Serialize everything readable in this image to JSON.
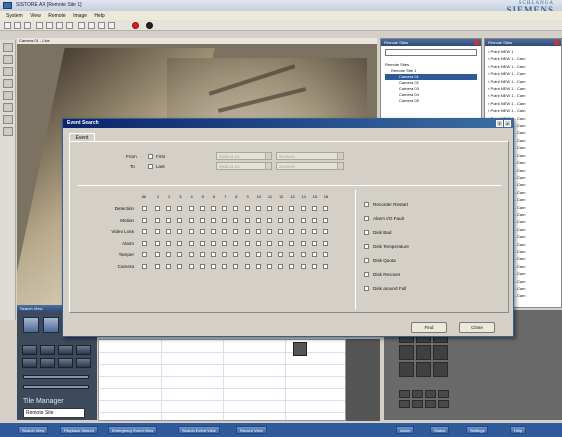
{
  "window": {
    "title": "SISTORE AX [Remote Site 1]",
    "brand_line1": "SCHLANGA",
    "brand_line2": "SIEMENS"
  },
  "menu": [
    "System",
    "View",
    "Remote",
    "Image",
    "Help"
  ],
  "video": {
    "title": "Camera 01 - Live"
  },
  "camera_panel": {
    "title": "Remote Sites",
    "tree": [
      {
        "label": "Remote Sites",
        "level": 0
      },
      {
        "label": "Remote Site 1",
        "level": 1
      },
      {
        "label": "Camera 01",
        "level": 2,
        "selected": true
      },
      {
        "label": "Camera 02",
        "level": 2
      },
      {
        "label": "Camera 03",
        "level": 2
      },
      {
        "label": "Camera 04",
        "level": 2
      },
      {
        "label": "Camera 05",
        "level": 2
      }
    ]
  },
  "record_panel": {
    "title": "Remote Sites",
    "items": [
      "Point NEW 1",
      "Point NEW 1 - Cam",
      "Point NEW 1 - Cam",
      "Point NEW 1 - Cam",
      "Point NEW 1 - Cam",
      "Point NEW 1 - Cam",
      "Point NEW 1 - Cam",
      "Point NEW 1 - Cam",
      "Point NEW 1 - Cam",
      "Point NEW 1 - Cam",
      "Point NEW 1 - Cam",
      "Point NEW 1 - Cam",
      "Point NEW 1 - Cam",
      "Point NEW 1 - Cam",
      "Point NEW 1 - Cam",
      "Point NEW 1 - Cam",
      "Point NEW 1 - Cam",
      "Point NEW 1 - Cam",
      "Point NEW 1 - Cam",
      "Point NEW 1 - Cam",
      "Point NEW 1 - Cam",
      "Point NEW 1 - Cam",
      "Point NEW 1 - Cam",
      "Point NEW 1 - Cam",
      "Point NEW 1 - Cam",
      "Point NEW 1 - Cam",
      "Point NEW 1 - Cam",
      "Point NEW 1 - Cam",
      "Point NEW 1 - Cam",
      "Point NEW 1 - Cam",
      "Point NEW 1 - Cam",
      "Point NEW 1 - Cam",
      "Point NEW 1 - Cam",
      "Point NEW 1 - Cam"
    ]
  },
  "lower_left": {
    "title": "Search View",
    "label": "Tile Manager",
    "select_value": "Remote Site"
  },
  "dialog": {
    "title": "Event Search",
    "tab": "Event",
    "from_label": "From",
    "to_label": "To",
    "first_label": "First",
    "last_label": "Last",
    "from_date": "2008-01-01",
    "from_time": "00:00:00",
    "to_date": "2008-01-01",
    "to_time": "23:59:59",
    "all_label": "All",
    "channels": [
      "1",
      "2",
      "3",
      "4",
      "5",
      "6",
      "7",
      "8",
      "9",
      "10",
      "11",
      "12",
      "13",
      "14",
      "15",
      "16"
    ],
    "rows": [
      "Detection",
      "Motion",
      "Video Loss",
      "Alarm",
      "Tamper",
      "Camera"
    ],
    "right_options": [
      "Recorder Restart",
      "Alarm I/O Fault",
      "Disk Bad",
      "Disk Temperature",
      "Disk Quota",
      "Disk Recover",
      "Disk around Full"
    ],
    "find_label": "Find",
    "close_label": "Close"
  },
  "taskbar": [
    "Search View",
    "Playback Search",
    "Emergency Event View",
    "Search Event View",
    "Record View"
  ],
  "taskbar_right": [
    "Alarm",
    "Status",
    "Settings",
    "Help"
  ]
}
